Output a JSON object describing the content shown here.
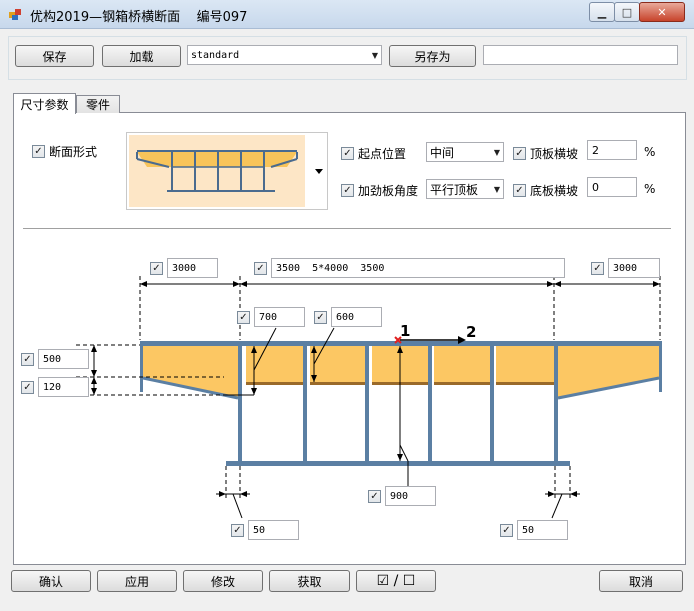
{
  "window": {
    "title": "优构2019—钢箱桥横断面    编号097",
    "min_symbol": "▁",
    "max_symbol": "□",
    "close_symbol": "✕"
  },
  "toolbar": {
    "save_label": "保存",
    "load_label": "加载",
    "template_value": "standard",
    "save_as_label": "另存为",
    "save_as_name": ""
  },
  "tabs": [
    {
      "label": "尺寸参数"
    },
    {
      "label": "零件"
    }
  ],
  "options": {
    "section_form_label": "断面形式",
    "start_position_label": "起点位置",
    "start_position_value": "中间",
    "stiffener_angle_label": "加劲板角度",
    "stiffener_angle_value": "平行顶板",
    "top_slope_label": "顶板横坡",
    "top_slope_value": "2",
    "bottom_slope_label": "底板横坡",
    "bottom_slope_value": "0",
    "percent_unit": "%",
    "check_mark": "✓"
  },
  "dimensions": {
    "left_overhang": "3000",
    "spans": "3500  5*4000  3500",
    "right_overhang": "3000",
    "web_offset": "700",
    "cell_width": "600",
    "depth_500": "500",
    "depth_120": "120",
    "bottom_gap": "900",
    "left_edge": "50",
    "right_edge": "50"
  },
  "markers": {
    "point1": "1",
    "point2": "2"
  },
  "footer": {
    "confirm_label": "确认",
    "apply_label": "应用",
    "modify_label": "修改",
    "fetch_label": "获取",
    "toggle_label": "☑ / ☐",
    "cancel_label": "取消"
  }
}
